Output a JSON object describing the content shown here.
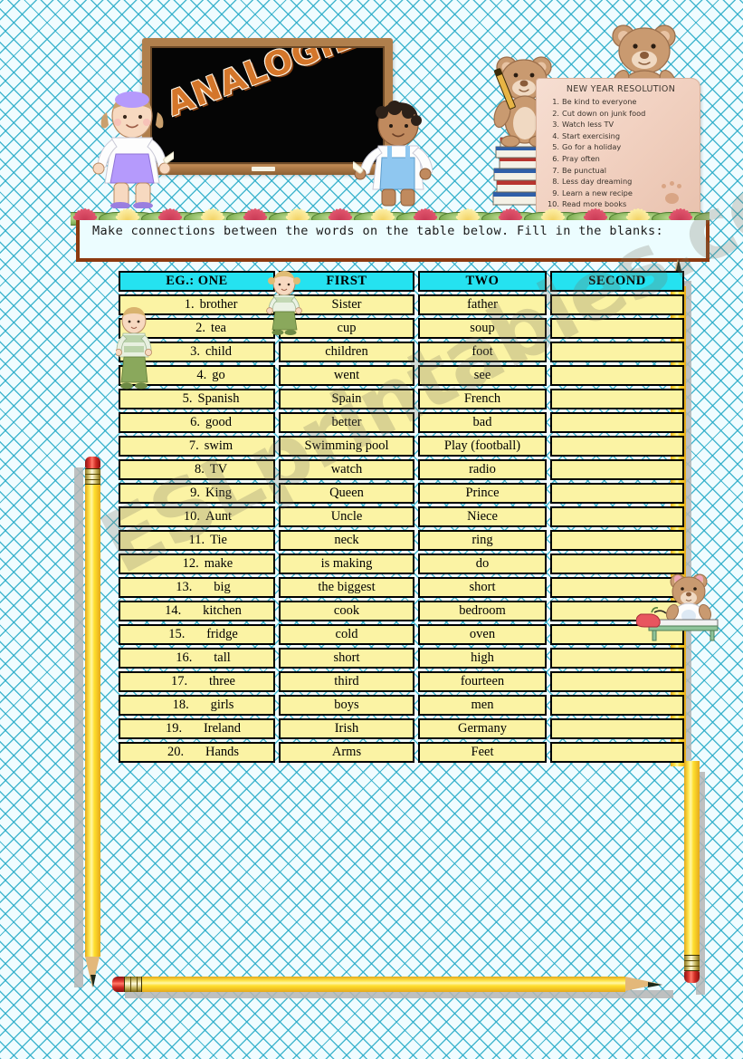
{
  "worksheet": {
    "title": "ANALOGIES",
    "instructions": "Make connections between the words on the table below. Fill in the blanks:",
    "watermark": "ESLprintables.com"
  },
  "resolution_note": {
    "title": "NEW YEAR RESOLUTION",
    "items": [
      {
        "num": "1.",
        "text": "Be kind to everyone"
      },
      {
        "num": "2.",
        "text": "Cut down on junk food"
      },
      {
        "num": "3.",
        "text": "Watch less TV"
      },
      {
        "num": "4.",
        "text": "Start exercising"
      },
      {
        "num": "5.",
        "text": "Go for a holiday"
      },
      {
        "num": "6.",
        "text": "Pray often"
      },
      {
        "num": "7.",
        "text": "Be punctual"
      },
      {
        "num": "8.",
        "text": "Less day dreaming"
      },
      {
        "num": "9.",
        "text": "Learn a new recipe"
      },
      {
        "num": "10.",
        "text": "Read more books"
      }
    ]
  },
  "table": {
    "headers": [
      "EG.: ONE",
      "FIRST",
      "TWO",
      "SECOND"
    ],
    "rows": [
      {
        "idx": "1.",
        "one": "brother",
        "first": "Sister",
        "two": "father",
        "second": ""
      },
      {
        "idx": "2.",
        "one": "tea",
        "first": "cup",
        "two": "soup",
        "second": ""
      },
      {
        "idx": "3.",
        "one": "child",
        "first": "children",
        "two": "foot",
        "second": ""
      },
      {
        "idx": "4.",
        "one": "go",
        "first": "went",
        "two": "see",
        "second": ""
      },
      {
        "idx": "5.",
        "one": "Spanish",
        "first": "Spain",
        "two": "French",
        "second": ""
      },
      {
        "idx": "6.",
        "one": "good",
        "first": "better",
        "two": "bad",
        "second": ""
      },
      {
        "idx": "7.",
        "one": "swim",
        "first": "Swimming pool",
        "two": "Play (football)",
        "second": ""
      },
      {
        "idx": "8.",
        "one": "TV",
        "first": "watch",
        "two": "radio",
        "second": ""
      },
      {
        "idx": "9.",
        "one": "King",
        "first": "Queen",
        "two": "Prince",
        "second": ""
      },
      {
        "idx": "10.",
        "one": "Aunt",
        "first": "Uncle",
        "two": "Niece",
        "second": ""
      },
      {
        "idx": "11.",
        "one": "Tie",
        "first": "neck",
        "two": "ring",
        "second": ""
      },
      {
        "idx": "12.",
        "one": "make",
        "first": "is making",
        "two": "do",
        "second": ""
      },
      {
        "idx": "13.",
        "one": "big",
        "first": "the biggest",
        "two": "short",
        "second": ""
      },
      {
        "idx": "14.",
        "one": "kitchen",
        "first": "cook",
        "two": "bedroom",
        "second": ""
      },
      {
        "idx": "15.",
        "one": "fridge",
        "first": "cold",
        "two": "oven",
        "second": ""
      },
      {
        "idx": "16.",
        "one": "tall",
        "first": "short",
        "two": "high",
        "second": ""
      },
      {
        "idx": "17.",
        "one": "three",
        "first": "third",
        "two": "fourteen",
        "second": ""
      },
      {
        "idx": "18.",
        "one": "girls",
        "first": "boys",
        "two": "men",
        "second": ""
      },
      {
        "idx": "19.",
        "one": "Ireland",
        "first": "Irish",
        "two": "Germany",
        "second": ""
      },
      {
        "idx": "20.",
        "one": "Hands",
        "first": "Arms",
        "two": "Feet",
        "second": ""
      }
    ]
  },
  "colors": {
    "header_cyan": "#25e2f0",
    "cell_yellow": "#fbf3a4",
    "frame_brown": "#8c3a10",
    "title_orange": "#d4762a",
    "background_cyan": "#eafafd",
    "pencil_yellow": "#ffdf2e"
  },
  "decorations": {
    "chalkboard": "chalkboard-icon",
    "girl": "girl-with-chalk-icon",
    "boy": "boy-with-chalk-icon",
    "bear_left": "teddy-bear-with-pencil-icon",
    "bear_right": "teddy-bear-icon",
    "books": "book-stack-icon",
    "scroll": "parchment-scroll-icon",
    "flowers": "water-lily-border-icon",
    "bear_desk": "teddy-bear-at-desk-icon",
    "apple": "apple-icon",
    "pencil_left": "pencil-icon",
    "pencil_right": "pencil-icon",
    "pencil_bottom": "pencil-icon",
    "pencil_table_right": "pencil-icon"
  }
}
